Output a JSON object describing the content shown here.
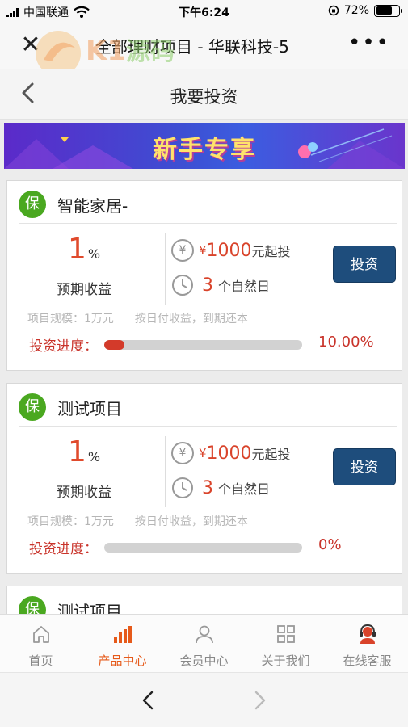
{
  "status_bar": {
    "carrier": "中国联通",
    "time": "下午6:24",
    "battery": "72%",
    "battery_level": 0.72
  },
  "title_bar": {
    "title": "全部理财项目 - 华联科技-5",
    "close_icon": "close-icon",
    "more_icon": "more-icon"
  },
  "watermark": {
    "text": "K1源码",
    "url": "k1ym.com"
  },
  "page_header": {
    "title": "我要投资"
  },
  "banner": {
    "text": "新手专享"
  },
  "products": [
    {
      "badge": "保",
      "name": "智能家居-",
      "rate": "1",
      "rate_unit": "%",
      "rate_label": "预期收益",
      "currency": "¥",
      "min_amount": "1000",
      "min_suffix": "元起投",
      "days": "3",
      "days_suffix": "个自然日",
      "button": "投资",
      "scale": "项目规模：1万元",
      "repayment": "按日付收益，到期还本",
      "progress_label": "投资进度：",
      "progress_value": 10.0,
      "progress_text": "10.00%"
    },
    {
      "badge": "保",
      "name": "测试项目",
      "rate": "1",
      "rate_unit": "%",
      "rate_label": "预期收益",
      "currency": "¥",
      "min_amount": "1000",
      "min_suffix": "元起投",
      "days": "3",
      "days_suffix": "个自然日",
      "button": "投资",
      "scale": "项目规模：1万元",
      "repayment": "按日付收益，到期还本",
      "progress_label": "投资进度：",
      "progress_value": 0,
      "progress_text": "0%"
    },
    {
      "badge": "保",
      "name": "测试项目"
    }
  ],
  "bottom_nav": [
    {
      "label": "首页",
      "icon": "home-icon",
      "active": false
    },
    {
      "label": "产品中心",
      "icon": "bar-chart-icon",
      "active": true
    },
    {
      "label": "会员中心",
      "icon": "user-icon",
      "active": false
    },
    {
      "label": "关于我们",
      "icon": "grid-icon",
      "active": false
    },
    {
      "label": "在线客服",
      "icon": "support-agent-icon",
      "active": false
    }
  ],
  "colors": {
    "accent": "#e65a1a",
    "primary_button": "#1e4d7c",
    "badge": "#4aa820",
    "rate": "#e04a2c"
  }
}
